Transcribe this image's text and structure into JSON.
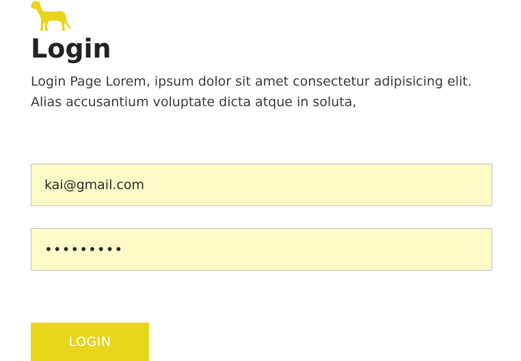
{
  "brand": {
    "logo_icon": "dog-icon",
    "logo_color": "#e8d51c"
  },
  "header": {
    "title": "Login",
    "description": "Login Page Lorem, ipsum dolor sit amet consectetur adipisicing elit. Alias accusantium voluptate dicta atque in soluta,"
  },
  "form": {
    "email_value": "kai@gmail.com",
    "password_value": "123456789",
    "field_background": "#fefbc8",
    "login_label": "LOGIN",
    "button_color": "#e8d51c"
  }
}
